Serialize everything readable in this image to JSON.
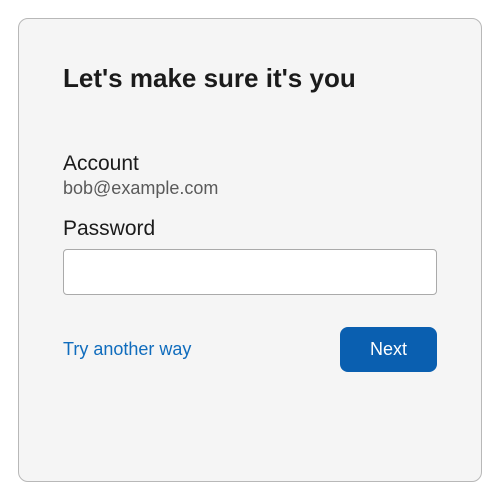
{
  "title": "Let's make sure it's you",
  "account": {
    "label": "Account",
    "value": "bob@example.com"
  },
  "password": {
    "label": "Password",
    "value": ""
  },
  "actions": {
    "try_another": "Try another way",
    "next": "Next"
  }
}
